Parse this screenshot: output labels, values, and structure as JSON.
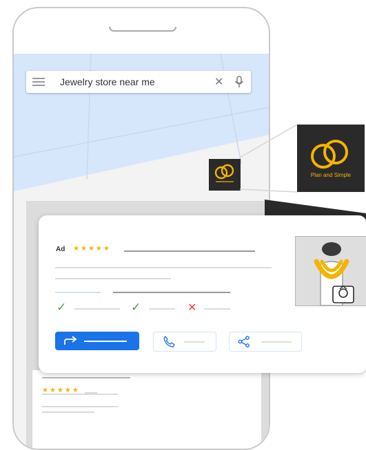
{
  "search": {
    "query": "Jewelry store near me"
  },
  "business": {
    "name": "Plan and Simple"
  },
  "ad_card": {
    "ad_label": "Ad",
    "stars_text": "★★★★★",
    "rating": 5
  },
  "features": [
    {
      "icon": "check",
      "symbol": "✓"
    },
    {
      "icon": "check",
      "symbol": "✓"
    },
    {
      "icon": "cross",
      "symbol": "✕"
    }
  ],
  "bottom_card": {
    "stars_text": "★★★★★",
    "rating": 5
  },
  "icons": [
    "menu-icon",
    "clear-icon",
    "mic-icon",
    "directions-icon",
    "phone-icon",
    "share-icon",
    "rings-logo-icon"
  ],
  "colors": {
    "primary": "#1a73e8",
    "star": "#f4b400",
    "check": "#34a853",
    "cross": "#ea4335",
    "map_water": "#d6e6fb",
    "logo_bg": "#2a2a2a"
  }
}
